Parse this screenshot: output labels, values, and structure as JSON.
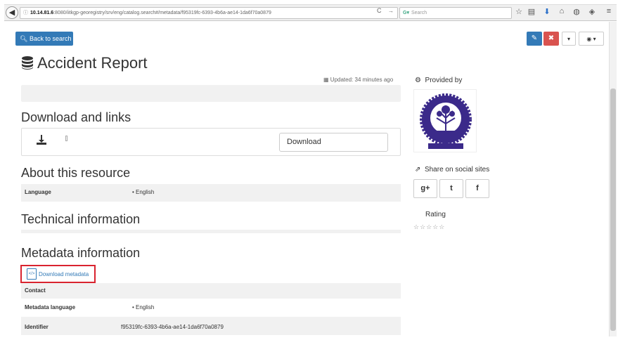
{
  "browser": {
    "url_host": "10.14.81.6",
    "url_rest": ":8080/iitkgp-georegistry/srv/eng/catalog.search#/metadata/f95319fc-6393-4b6a-ae14-1da6f70a0879",
    "search_placeholder": "Search"
  },
  "toolbar": {
    "back_label": "Back to search"
  },
  "record": {
    "title": "Accident Report",
    "updated": "Updated: 34 minutes ago"
  },
  "sections": {
    "download_title": "Download and links",
    "download_button": "Download",
    "about_title": "About this resource",
    "technical_title": "Technical information",
    "metadata_title": "Metadata information",
    "download_metadata": "Download metadata"
  },
  "about_rows": [
    {
      "key": "Language",
      "value": "• English"
    }
  ],
  "metadata_rows": [
    {
      "key": "Contact",
      "value": ""
    },
    {
      "key": "Metadata language",
      "value": "• English"
    },
    {
      "key": "Identifier",
      "value": "f95319fc-6393-4b6a-ae14-1da6f70a0879"
    }
  ],
  "sidebar": {
    "provided_by": "Provided by",
    "share_title": "Share on social sites",
    "rating_title": "Rating",
    "stars": "☆☆☆☆☆",
    "social_buttons": [
      "g+",
      "t",
      "f"
    ]
  },
  "colors": {
    "primary": "#337ab7",
    "danger": "#d9534f",
    "highlight": "#d9232f"
  }
}
